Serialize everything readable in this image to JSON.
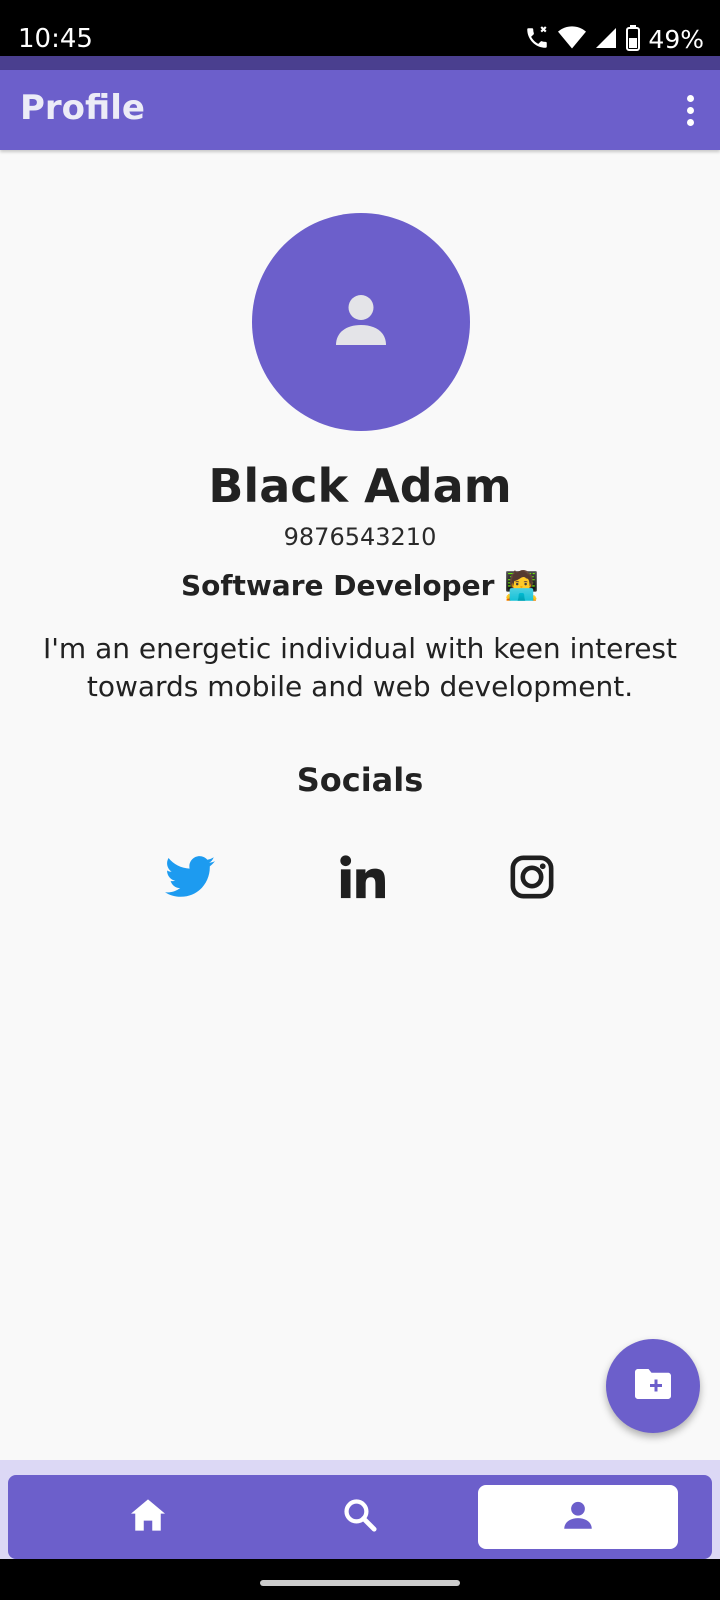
{
  "status_bar": {
    "time": "10:45",
    "battery": "49%",
    "icons": [
      "call-icon",
      "wifi-icon",
      "signal-icon",
      "battery-icon"
    ]
  },
  "app_bar": {
    "title": "Profile",
    "menu_icon": "more-vert-icon"
  },
  "profile": {
    "avatar_icon": "person-icon",
    "name": "Black Adam",
    "phone": "9876543210",
    "role": "Software Developer 🧑‍💻",
    "bio": "I'm an energetic individual with keen interest towards mobile and web development."
  },
  "socials": {
    "title": "Socials",
    "items": [
      {
        "icon": "twitter-icon",
        "color": "#1d9bf0"
      },
      {
        "icon": "linkedin-icon",
        "color": "#1f1f1f"
      },
      {
        "icon": "instagram-icon",
        "color": "#1f1f1f"
      }
    ]
  },
  "fab": {
    "icon": "create-folder-icon"
  },
  "bottom_nav": {
    "items": [
      {
        "icon": "home-icon",
        "active": false
      },
      {
        "icon": "search-icon",
        "active": false
      },
      {
        "icon": "person-icon",
        "active": true
      }
    ]
  },
  "colors": {
    "primary": "#6c5fcb",
    "background": "#f9f9f9",
    "nav_background": "#dcd8f5"
  }
}
